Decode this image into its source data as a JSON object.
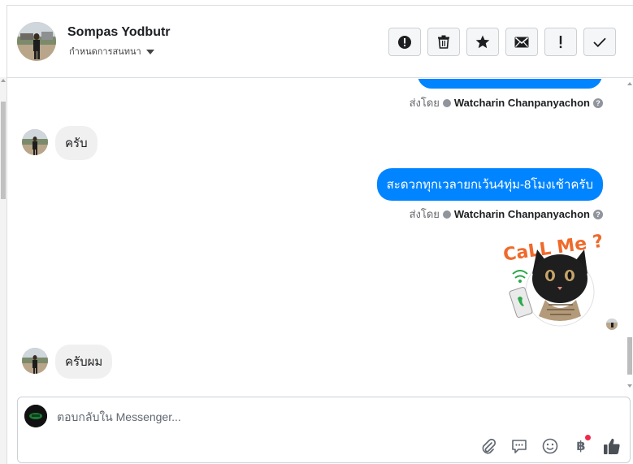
{
  "header": {
    "contact_name": "Sompas Yodbutr",
    "conversation_settings_label": "กำหนดการสนทนา",
    "actions": [
      {
        "name": "report-button",
        "icon": "alert-circle-icon"
      },
      {
        "name": "delete-button",
        "icon": "trash-icon"
      },
      {
        "name": "star-button",
        "icon": "star-icon"
      },
      {
        "name": "mark-unread-button",
        "icon": "envelope-icon"
      },
      {
        "name": "important-button",
        "icon": "exclamation-icon"
      },
      {
        "name": "mark-done-button",
        "icon": "check-icon"
      }
    ]
  },
  "messages": {
    "sent_by_label": "ส่งโดย",
    "sender_name": "Watcharin Chanpanyachon",
    "incoming_1": "ครับ",
    "outgoing_2": "สะดวกทุกเวลายกเว้น4ทุ่ม-8โมงเช้าครับ",
    "sticker_text": "CaLL Me ?",
    "incoming_2": "ครับผม"
  },
  "composer": {
    "placeholder": "ตอบกลับใน Messenger...",
    "currency_symbol": "฿"
  },
  "colors": {
    "outgoing_bubble": "#0084ff",
    "incoming_bubble": "#f1f0f0",
    "notification_dot": "#f02849"
  }
}
